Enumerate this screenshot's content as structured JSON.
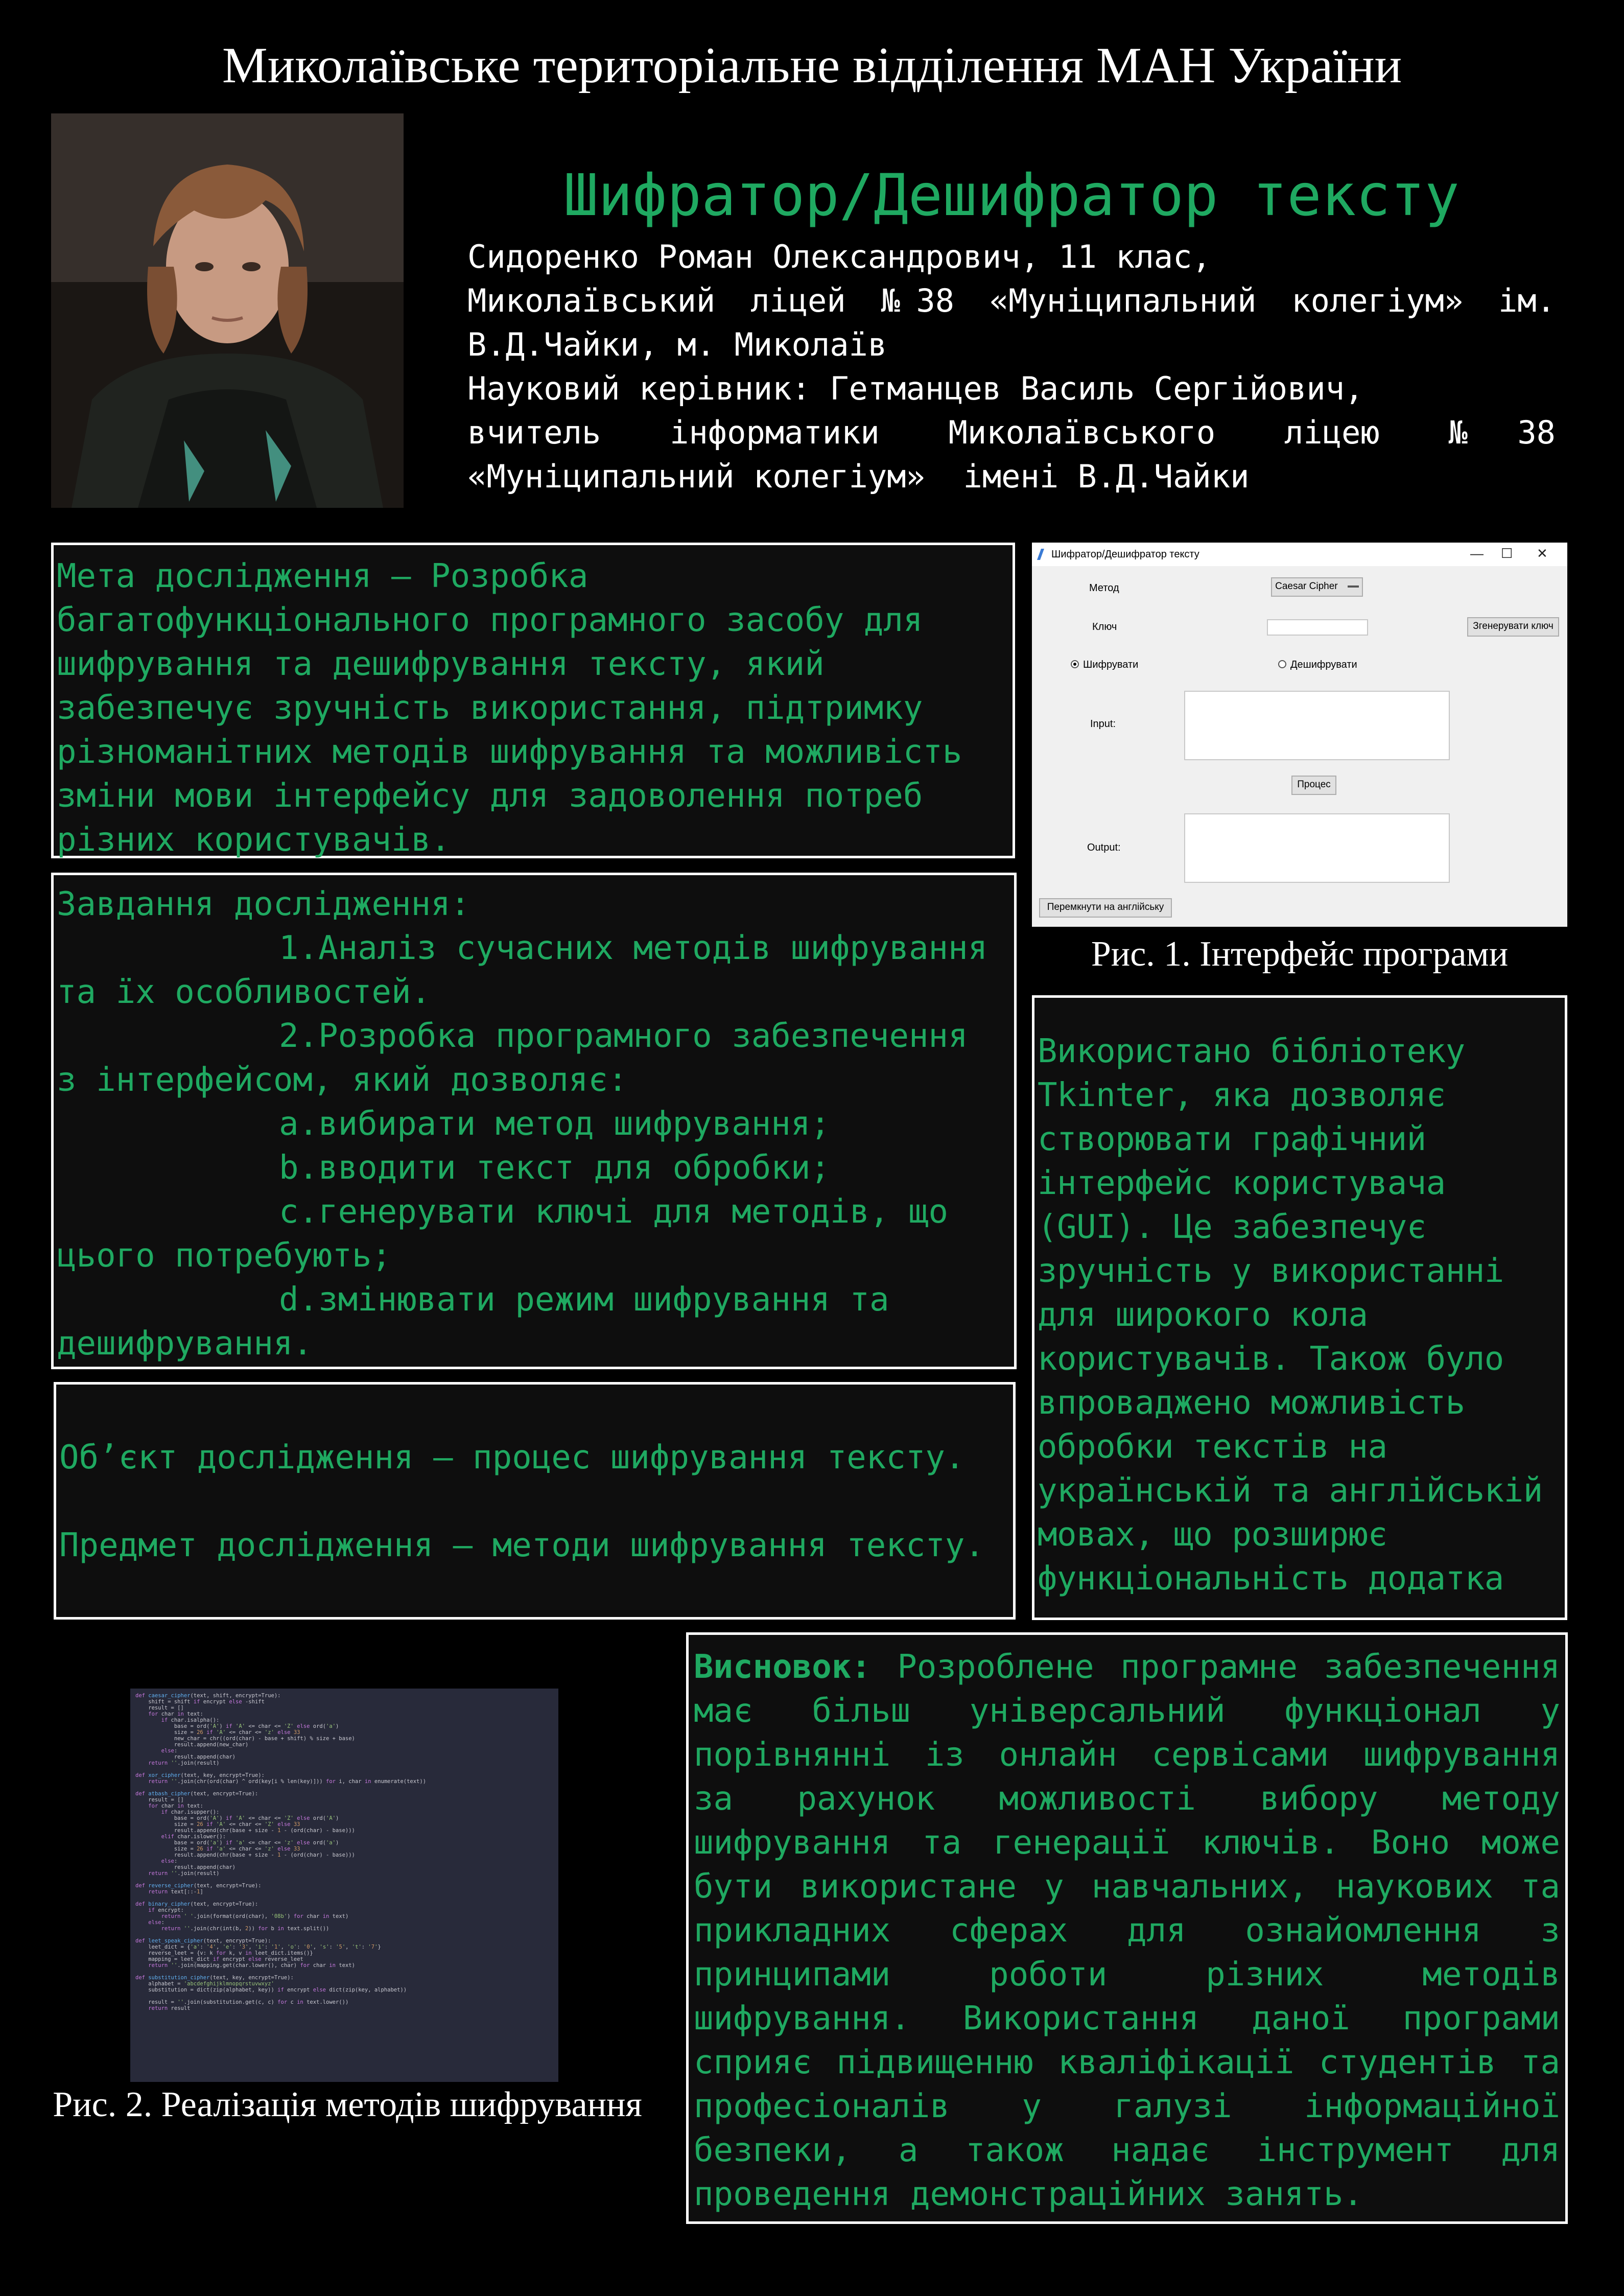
{
  "header": {
    "title": "Миколаївське територіальне відділення МАН України"
  },
  "main_title": "Шифратор/Дешифратор тексту",
  "author": {
    "lines": [
      "Сидоренко Роман Олександрович, 11 клас,",
      "Миколаївський ліцей №38 «Муніципальний колегіум» ім.",
      "В.Д.Чайки, м. Миколаїв",
      "Науковий керівник: Гетманцев Василь Сергійович,",
      "вчитель інформатики Миколаївського ліцею №38",
      "«Муніципальний колегіум»  імені В.Д.Чайки"
    ]
  },
  "aim": {
    "lines": [
      "Мета дослідження – Розробка",
      "багатофункціонального програмного засобу для",
      "шифрування та дешифрування тексту, який",
      "забезпечує зручність використання, підтримку",
      "різноманітних методів шифрування та можливість",
      "зміни мови інтерфейсу для задоволення потреб",
      "різних користувачів."
    ]
  },
  "tasks": {
    "heading": "Завдання дослідження:",
    "t1a": "1.Аналіз сучасних методів шифрування",
    "t1b": "та їх особливостей.",
    "t2a": "2.Розробка програмного забезпечення",
    "t2b": "з інтерфейсом, який дозволяє:",
    "ta": "a.вибирати метод шифрування;",
    "tb": "b.вводити текст для обробки;",
    "tc1": "c.генерувати ключі для методів, що",
    "tc2": "цього потребують;",
    "td1": "d.змінювати режим шифрування та",
    "td2": "дешифрування."
  },
  "object_subject": {
    "object": "Об’єкт дослідження – процес шифрування тексту.",
    "subject": "Предмет дослідження – методи шифрування тексту."
  },
  "app_window": {
    "title": "Шифратор/Дешифратор тексту",
    "controls": {
      "minimize": "—",
      "maximize": "☐",
      "close": "✕"
    },
    "method_label": "Метод",
    "method_value": "Caesar Cipher",
    "key_label": "Ключ",
    "generate_key_button": "Згенерувати ключ",
    "encrypt_radio": "Шифрувати",
    "decrypt_radio": "Дешифрувати",
    "input_label": "Input:",
    "process_button": "Процес",
    "output_label": "Output:",
    "switch_language_button": "Перемкнути на англійську"
  },
  "fig1_caption": "Рис. 1. Інтерфейс програми",
  "tkinter": {
    "lines": [
      "Використано бібліотеку",
      "Tkinter, яка дозволяє",
      "створювати графічний",
      "інтерфейс користувача",
      "(GUI). Це забезпечує",
      "зручність у використанні",
      "для широкого кола",
      "користувачів. Також було",
      "впроваджено можливість",
      "обробки текстів на",
      "українській та англійській",
      "мовах, що розширює",
      "функціональність додатка"
    ]
  },
  "conclusion": {
    "label": "Висновок:",
    "first_rest": " Розроблене програмне забезпечення",
    "lines": [
      "має більш універсальний функціонал у",
      "порівнянні із онлайн сервісами шифрування",
      "за рахунок можливості вибору методу",
      "шифрування та генерації ключів. Воно може",
      "бути використане у навчальних, наукових та",
      "прикладних сферах для ознайомлення з",
      "принципами роботи різних методів",
      "шифрування. Використання даної програми",
      "сприяє підвищенню кваліфікації студентів та",
      "професіоналів у галузі інформаційної",
      "безпеки, а також надає інструмент для"
    ],
    "last": "проведення демонстраційних занять."
  },
  "fig2_caption": "Рис. 2. Реалізація методів шифрування",
  "code_lines": [
    "def caesar_cipher(text, shift, encrypt=True):",
    "    shift = shift if encrypt else -shift",
    "    result = []",
    "    for char in text:",
    "        if char.isalpha():",
    "            base = ord('A') if 'A' <= char <= 'Z' else ord('a')",
    "            size = 26 if 'A' <= char <= 'z' else 33",
    "            new_char = chr((ord(char) - base + shift) % size + base)",
    "            result.append(new_char)",
    "        else:",
    "            result.append(char)",
    "    return ''.join(result)",
    "",
    "def xor_cipher(text, key, encrypt=True):",
    "    return ''.join(chr(ord(char) ^ ord(key[i % len(key)])) for i, char in enumerate(text))",
    "",
    "def atbash_cipher(text, encrypt=True):",
    "    result = []",
    "    for char in text:",
    "        if char.isupper():",
    "            base = ord('A') if 'A' <= char <= 'Z' else ord('A')",
    "            size = 26 if 'A' <= char <= 'Z' else 33",
    "            result.append(chr(base + size - 1 - (ord(char) - base)))",
    "        elif char.islower():",
    "            base = ord('a') if 'a' <= char <= 'z' else ord('a')",
    "            size = 26 if 'a' <= char <= 'z' else 33",
    "            result.append(chr(base + size - 1 - (ord(char) - base)))",
    "        else:",
    "            result.append(char)",
    "    return ''.join(result)",
    "",
    "def reverse_cipher(text, encrypt=True):",
    "    return text[::-1]",
    "",
    "def binary_cipher(text, encrypt=True):",
    "    if encrypt:",
    "        return ' '.join(format(ord(char), '08b') for char in text)",
    "    else:",
    "        return ''.join(chr(int(b, 2)) for b in text.split())",
    "",
    "def leet_speak_cipher(text, encrypt=True):",
    "    leet_dict = {'a': '4', 'e': '3', 'i': '1', 'o': '0', 's': '5', 't': '7'}",
    "    reverse_leet = {v: k for k, v in leet_dict.items()}",
    "    mapping = leet_dict if encrypt else reverse_leet",
    "    return ''.join(mapping.get(char.lower(), char) for char in text)",
    "",
    "def substitution_cipher(text, key, encrypt=True):",
    "    alphabet = 'abcdefghijklmnopqrstuvwxyz'",
    "    substitution = dict(zip(alphabet, key)) if encrypt else dict(zip(key, alphabet))",
    "",
    "    result = ''.join(substitution.get(c, c) for c in text.lower())",
    "    return result"
  ]
}
